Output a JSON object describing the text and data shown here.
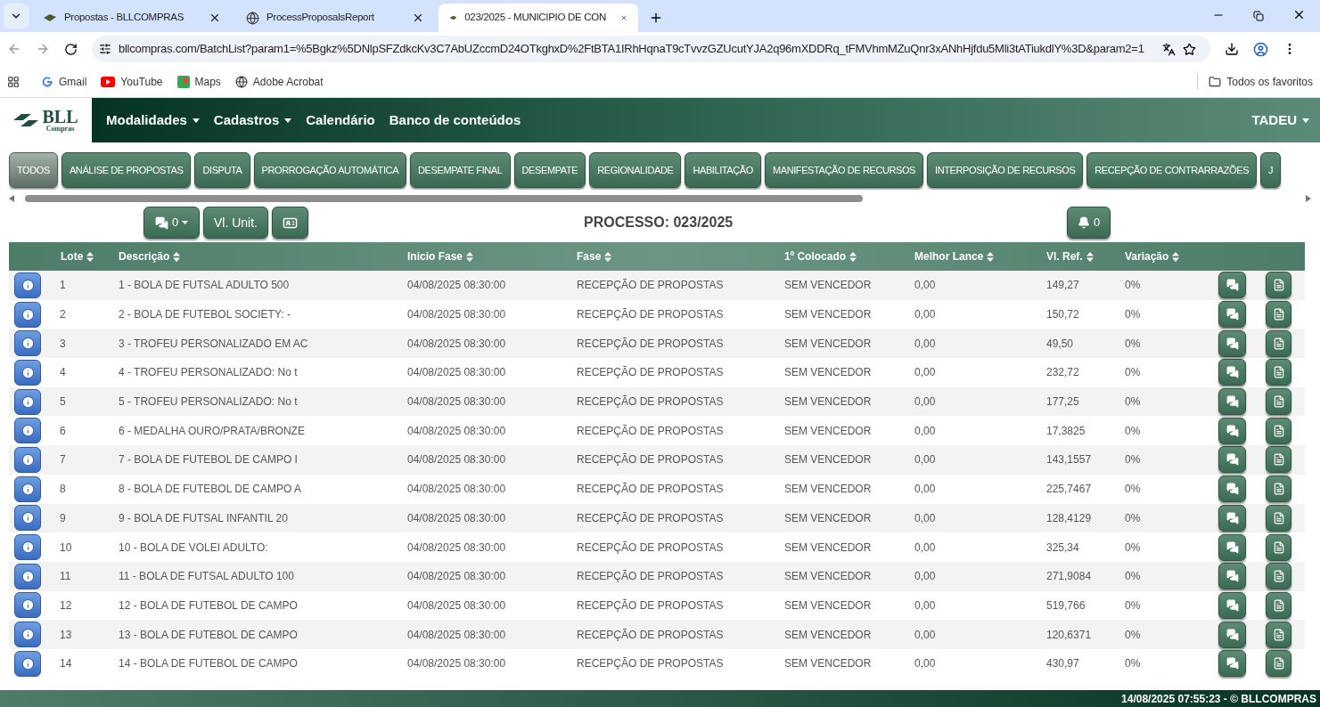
{
  "browser": {
    "tabs": [
      {
        "title": "Propostas - BLLCOMPRAS",
        "selected": false
      },
      {
        "title": "ProcessProposalsReport",
        "selected": false
      },
      {
        "title": "023/2025 - MUNICIPIO DE CON",
        "selected": true
      }
    ],
    "url": "bllcompras.com/BatchList?param1=%5Bgkz%5DNlpSFZdkcKv3C7AbUZccmD24OTkghxD%2FtBTA1IRhHqnaT9cTvvzGZUcutYJA2q96mXDDRq_tFMVhmMZuQnr3xANhHjfdu5Mli3tATiukdlY%3D&param2=1",
    "bookmarks": [
      "Gmail",
      "YouTube",
      "Maps",
      "Adobe Acrobat"
    ],
    "all_bookmarks": "Todos os favoritos"
  },
  "logo": {
    "name": "BLL",
    "sub": "Compras"
  },
  "nav": {
    "items": [
      {
        "label": "Modalidades",
        "dropdown": true
      },
      {
        "label": "Cadastros",
        "dropdown": true
      },
      {
        "label": "Calendário",
        "dropdown": false
      },
      {
        "label": "Banco de conteúdos",
        "dropdown": false
      }
    ],
    "user": "TADEU"
  },
  "phases": [
    {
      "label": "TODOS",
      "selected": true
    },
    {
      "label": "ANÁLISE DE PROPOSTAS",
      "selected": false
    },
    {
      "label": "DISPUTA",
      "selected": false
    },
    {
      "label": "PRORROGAÇÃO AUTOMÁTICA",
      "selected": false
    },
    {
      "label": "DESEMPATE FINAL",
      "selected": false
    },
    {
      "label": "DESEMPATE",
      "selected": false
    },
    {
      "label": "REGIONALIDADE",
      "selected": false
    },
    {
      "label": "HABILITAÇÃO",
      "selected": false
    },
    {
      "label": "MANIFESTAÇÃO DE RECURSOS",
      "selected": false
    },
    {
      "label": "INTERPOSIÇÃO DE RECURSOS",
      "selected": false
    },
    {
      "label": "RECEPÇÃO DE CONTRARRAZÕES",
      "selected": false
    },
    {
      "label": "J",
      "selected": false
    }
  ],
  "toolbar": {
    "messages": "0",
    "unit_value": "Vl. Unit.",
    "title": "PROCESSO: 023/2025",
    "notifications": "0"
  },
  "table": {
    "columns": [
      "Lote",
      "Descrição",
      "Inicio Fase",
      "Fase",
      "1º Colocado",
      "Melhor Lance",
      "Vl. Ref.",
      "Variação"
    ],
    "rows": [
      [
        "1",
        "1 - BOLA DE FUTSAL ADULTO 500",
        "04/08/2025 08:30:00",
        "RECEPÇÃO DE PROPOSTAS",
        "SEM VENCEDOR",
        "0,00",
        "149,27",
        "0%"
      ],
      [
        "2",
        "2 - BOLA DE FUTEBOL SOCIETY: -",
        "04/08/2025 08:30:00",
        "RECEPÇÃO DE PROPOSTAS",
        "SEM VENCEDOR",
        "0,00",
        "150,72",
        "0%"
      ],
      [
        "3",
        "3 - TROFEU PERSONALIZADO EM AC",
        "04/08/2025 08:30:00",
        "RECEPÇÃO DE PROPOSTAS",
        "SEM VENCEDOR",
        "0,00",
        "49,50",
        "0%"
      ],
      [
        "4",
        "4 - TROFEU PERSONALIZADO: No t",
        "04/08/2025 08:30:00",
        "RECEPÇÃO DE PROPOSTAS",
        "SEM VENCEDOR",
        "0,00",
        "232,72",
        "0%"
      ],
      [
        "5",
        "5 - TROFEU PERSONALIZADO: No t",
        "04/08/2025 08:30:00",
        "RECEPÇÃO DE PROPOSTAS",
        "SEM VENCEDOR",
        "0,00",
        "177,25",
        "0%"
      ],
      [
        "6",
        "6 - MEDALHA OURO/PRATA/BRONZE",
        "04/08/2025 08:30:00",
        "RECEPÇÃO DE PROPOSTAS",
        "SEM VENCEDOR",
        "0,00",
        "17,3825",
        "0%"
      ],
      [
        "7",
        "7 - BOLA DE FUTEBOL DE CAMPO I",
        "04/08/2025 08:30:00",
        "RECEPÇÃO DE PROPOSTAS",
        "SEM VENCEDOR",
        "0,00",
        "143,1557",
        "0%"
      ],
      [
        "8",
        "8 - BOLA DE FUTEBOL DE CAMPO A",
        "04/08/2025 08:30:00",
        "RECEPÇÃO DE PROPOSTAS",
        "SEM VENCEDOR",
        "0,00",
        "225,7467",
        "0%"
      ],
      [
        "9",
        "9 - BOLA DE FUTSAL INFANTIL 20",
        "04/08/2025 08:30:00",
        "RECEPÇÃO DE PROPOSTAS",
        "SEM VENCEDOR",
        "0,00",
        "128,4129",
        "0%"
      ],
      [
        "10",
        "10 - BOLA DE VOLEI ADULTO:",
        "04/08/2025 08:30:00",
        "RECEPÇÃO DE PROPOSTAS",
        "SEM VENCEDOR",
        "0,00",
        "325,34",
        "0%"
      ],
      [
        "11",
        "11 - BOLA DE FUTSAL ADULTO 100",
        "04/08/2025 08:30:00",
        "RECEPÇÃO DE PROPOSTAS",
        "SEM VENCEDOR",
        "0,00",
        "271,9084",
        "0%"
      ],
      [
        "12",
        "12 - BOLA DE FUTEBOL DE CAMPO",
        "04/08/2025 08:30:00",
        "RECEPÇÃO DE PROPOSTAS",
        "SEM VENCEDOR",
        "0,00",
        "519,766",
        "0%"
      ],
      [
        "13",
        "13 - BOLA DE FUTEBOL DE CAMPO",
        "04/08/2025 08:30:00",
        "RECEPÇÃO DE PROPOSTAS",
        "SEM VENCEDOR",
        "0,00",
        "120,6371",
        "0%"
      ],
      [
        "14",
        "14 - BOLA DE FUTEBOL DE CAMPO",
        "04/08/2025 08:30:00",
        "RECEPÇÃO DE PROPOSTAS",
        "SEM VENCEDOR",
        "0,00",
        "430,97",
        "0%"
      ]
    ]
  },
  "footer": "14/08/2025 07:55:23 - © BLLCOMPRAS"
}
